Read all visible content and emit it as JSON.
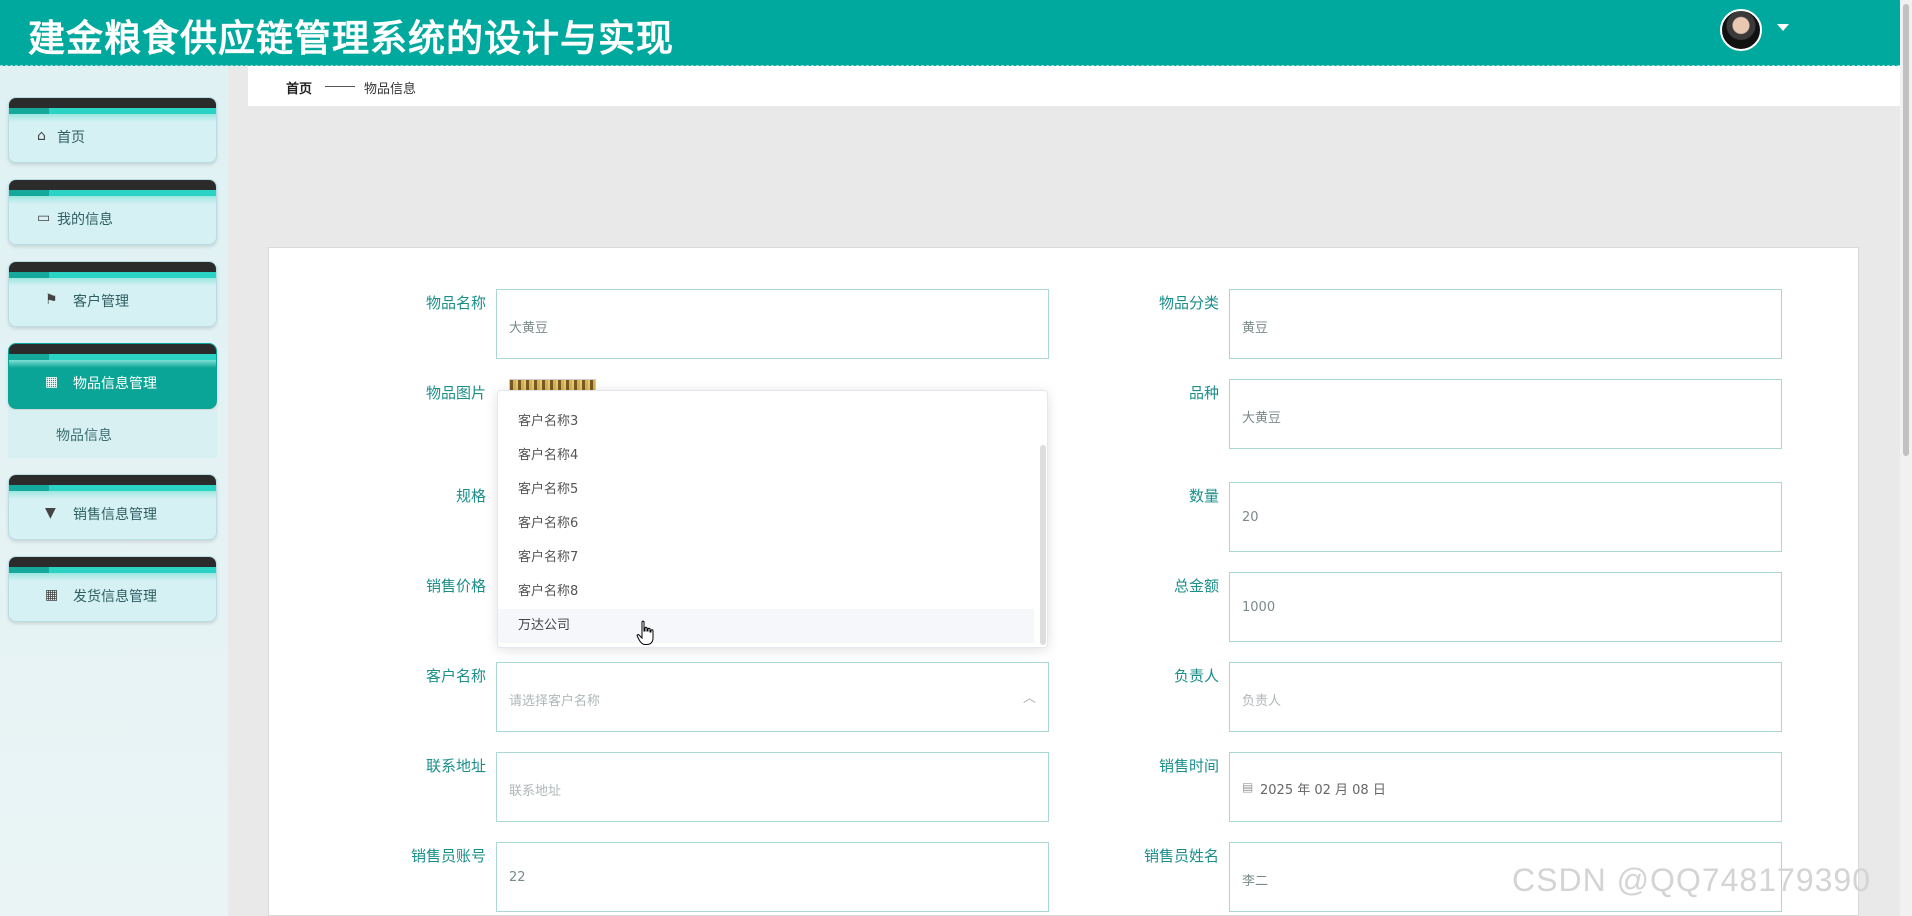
{
  "header": {
    "title": "建金粮食供应链管理系统的设计与实现",
    "avatar_icon": "user-avatar",
    "caret_icon": "caret-down-icon"
  },
  "sidebar": {
    "items": [
      {
        "label": "首页",
        "icon": "home-icon"
      },
      {
        "label": "我的信息",
        "icon": "wallet-icon"
      },
      {
        "label": "客户管理",
        "icon": "flag-icon"
      },
      {
        "label": "物品信息管理",
        "icon": "grid-icon"
      },
      {
        "label": "销售信息管理",
        "icon": "brush-icon"
      },
      {
        "label": "发货信息管理",
        "icon": "grid-icon"
      }
    ],
    "submenu": {
      "label": "物品信息"
    }
  },
  "breadcrumb": {
    "home": "首页",
    "current": "物品信息"
  },
  "form": {
    "item_name": {
      "label": "物品名称",
      "value": "大黄豆"
    },
    "item_category": {
      "label": "物品分类",
      "value": "黄豆"
    },
    "item_image": {
      "label": "物品图片"
    },
    "variety": {
      "label": "品种",
      "value": "大黄豆"
    },
    "spec": {
      "label": "规格"
    },
    "quantity": {
      "label": "数量",
      "value": "20"
    },
    "sale_price": {
      "label": "销售价格"
    },
    "total_amount": {
      "label": "总金额",
      "value": "1000"
    },
    "customer_name": {
      "label": "客户名称",
      "placeholder": "请选择客户名称"
    },
    "person_in_charge": {
      "label": "负责人",
      "placeholder": "负责人"
    },
    "contact_address": {
      "label": "联系地址",
      "placeholder": "联系地址"
    },
    "sale_time": {
      "label": "销售时间",
      "value": "2025 年 02 月 08 日"
    },
    "salesperson_account": {
      "label": "销售员账号",
      "value": "22"
    },
    "salesperson_name": {
      "label": "销售员姓名",
      "value": "李二"
    }
  },
  "dropdown": {
    "options": [
      "客户名称3",
      "客户名称4",
      "客户名称5",
      "客户名称6",
      "客户名称7",
      "客户名称8",
      "万达公司"
    ],
    "hovered": "万达公司"
  },
  "watermark": "CSDN @QQ748179390",
  "colors": {
    "header": "#00a99d",
    "accent": "#1a8f8a",
    "active_menu": "#0aa596"
  }
}
